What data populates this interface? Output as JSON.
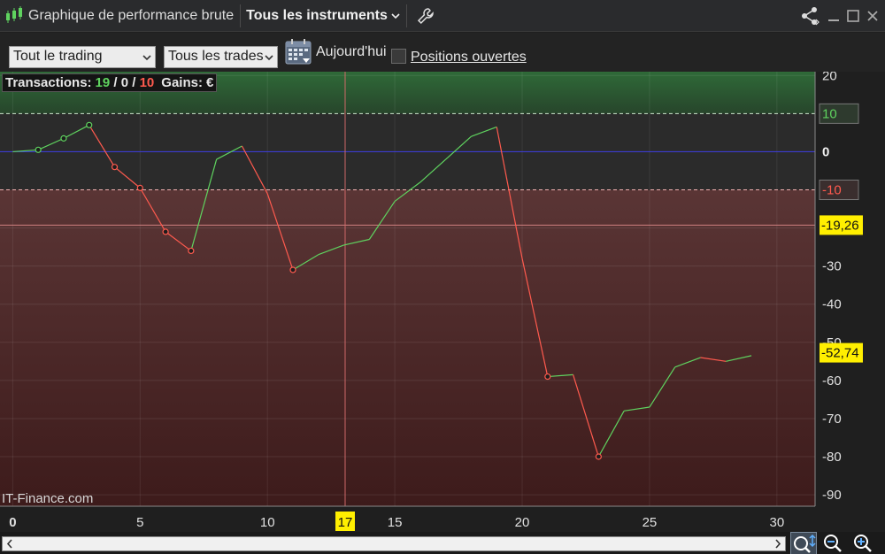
{
  "window": {
    "title": "Graphique de performance brute",
    "instrument": "Tous les instruments"
  },
  "toolbar": {
    "period_select": "Tout le trading",
    "trades_select": "Tous les trades",
    "today_label": "Aujourd'hui",
    "open_positions_label": "Positions ouvertes",
    "open_positions_checked": false
  },
  "info": {
    "transactions_label": "Transactions:",
    "winning": "19",
    "sep1": "/",
    "neutral": "0",
    "sep2": "/",
    "losing": "10",
    "gains_label": "Gains:",
    "gains_unit": "€"
  },
  "watermark": "IT-Finance.com",
  "colors": {
    "gain": "#5fd35f",
    "loss": "#ff5a4e",
    "zero_line": "#3c3cd0",
    "marker": "#ffef00"
  },
  "chart_data": {
    "type": "line",
    "x": [
      0,
      1,
      2,
      3,
      4,
      5,
      6,
      7,
      8,
      9,
      10,
      11,
      12,
      13,
      14,
      15,
      16,
      17,
      18,
      19,
      20,
      21,
      22,
      23,
      24,
      25,
      26,
      27,
      28,
      29
    ],
    "values": [
      0,
      0.5,
      3.5,
      7,
      -4,
      -9.5,
      -21,
      -26,
      -2,
      1.5,
      -11,
      -31,
      -27,
      -24.5,
      -23,
      -13,
      -8,
      -2,
      4,
      6.5,
      -28,
      -59,
      -58.5,
      -80,
      -68,
      -67,
      -56.5,
      -54,
      -55,
      -53.5
    ],
    "markers": [
      1,
      2,
      3,
      4,
      5,
      6,
      7,
      11,
      21,
      23
    ],
    "ylim": [
      -93,
      21
    ],
    "xlim": [
      -0.5,
      31.5
    ],
    "y_ticks": [
      20,
      10,
      0,
      -10,
      -20,
      -30,
      -40,
      -50,
      -60,
      -70,
      -80,
      -90
    ],
    "y_tick_labels": [
      "20",
      "10",
      "0",
      "-10",
      "-20",
      "-30",
      "-40",
      "-50",
      "-60",
      "-70",
      "-80",
      "-90"
    ],
    "x_ticks": [
      0,
      5,
      10,
      15,
      20,
      25,
      30
    ],
    "x_tick_labels": [
      "0",
      "5",
      "10",
      "15",
      "20",
      "25",
      "30"
    ],
    "upper_band": 10,
    "upper_band_label": "10",
    "lower_band": -10,
    "lower_band_label": "-10",
    "zero_label": "0",
    "avg_line": -19.26,
    "avg_line_label": "-19,26",
    "last_value_label": "-52,74",
    "last_value": -52.74,
    "cursor_x": 13.05,
    "cursor_x_label": "17",
    "grid": true
  }
}
